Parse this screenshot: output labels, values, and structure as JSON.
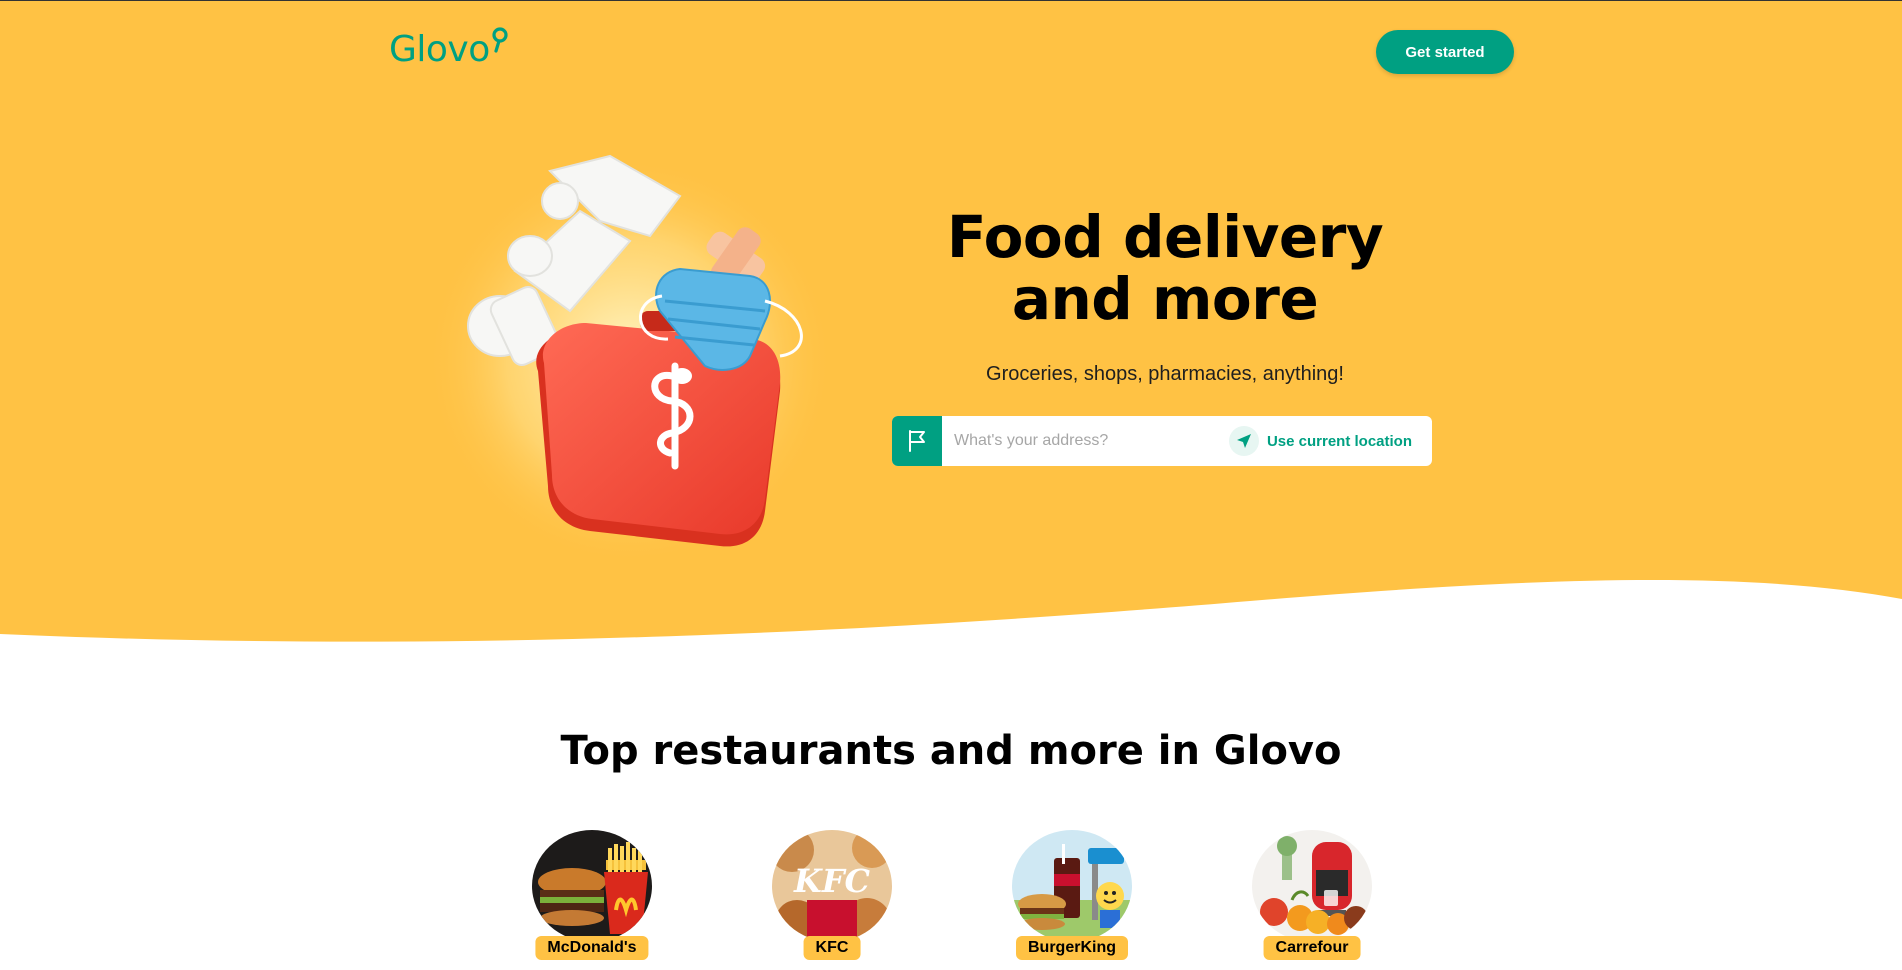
{
  "brand": {
    "name": "Glovo",
    "primary_color": "#00a082",
    "hero_color": "#ffc244"
  },
  "header": {
    "get_started_label": "Get started"
  },
  "hero": {
    "headline": "Food delivery and more",
    "subline": "Groceries, shops, pharmacies, anything!",
    "address_placeholder": "What's your address?",
    "use_location_label": "Use current location",
    "illustration": "first-aid-kit-with-bandage-plaster-and-mask"
  },
  "stores_section": {
    "title": "Top restaurants and more in Glovo",
    "stores": [
      {
        "label": "McDonald's",
        "image": "burger-and-fries"
      },
      {
        "label": "KFC",
        "image": "kfc-chicken-bucket"
      },
      {
        "label": "BurgerKing",
        "image": "burger-and-cola"
      },
      {
        "label": "Carrefour",
        "image": "fruits-and-coffee-machine"
      }
    ]
  }
}
